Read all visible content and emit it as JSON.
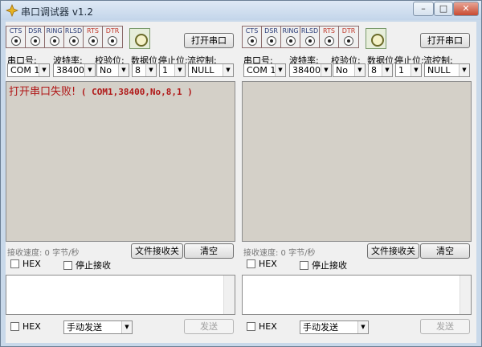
{
  "window": {
    "title": "串口调试器 v1.2"
  },
  "window_controls": {
    "minimize": "–",
    "maximize": "□",
    "close": "✕"
  },
  "signals": [
    {
      "label": "CTS",
      "type": "in"
    },
    {
      "label": "DSR",
      "type": "in"
    },
    {
      "label": "RING",
      "type": "in"
    },
    {
      "label": "RLSD",
      "type": "in"
    },
    {
      "label": "RTS",
      "type": "out"
    },
    {
      "label": "DTR",
      "type": "out"
    }
  ],
  "labels": {
    "port": "串口号:",
    "baud": "波特率:",
    "parity": "校验位:",
    "databits": "数据位:",
    "stopbits": "停止位:",
    "flow": "流控制:",
    "open_button": "打开串口",
    "file_recv_button": "文件接收关",
    "clear_button": "清空",
    "hex": "HEX",
    "stop_recv": "停止接收",
    "send_button": "发送"
  },
  "left": {
    "port": "COM 1",
    "baud": "38400",
    "parity": "No",
    "databits": "8",
    "stopbits": "1",
    "flow": "NULL",
    "recv_error": "打开串口失败!",
    "recv_params": " ( COM1,38400,No,8,1 )",
    "speed": "接收速度: 0 字节/秒",
    "send_mode": "手动发送"
  },
  "right": {
    "port": "COM 1",
    "baud": "38400",
    "parity": "No",
    "databits": "8",
    "stopbits": "1",
    "flow": "NULL",
    "speed": "接收速度: 0 字节/秒",
    "send_mode": "手动发送"
  }
}
